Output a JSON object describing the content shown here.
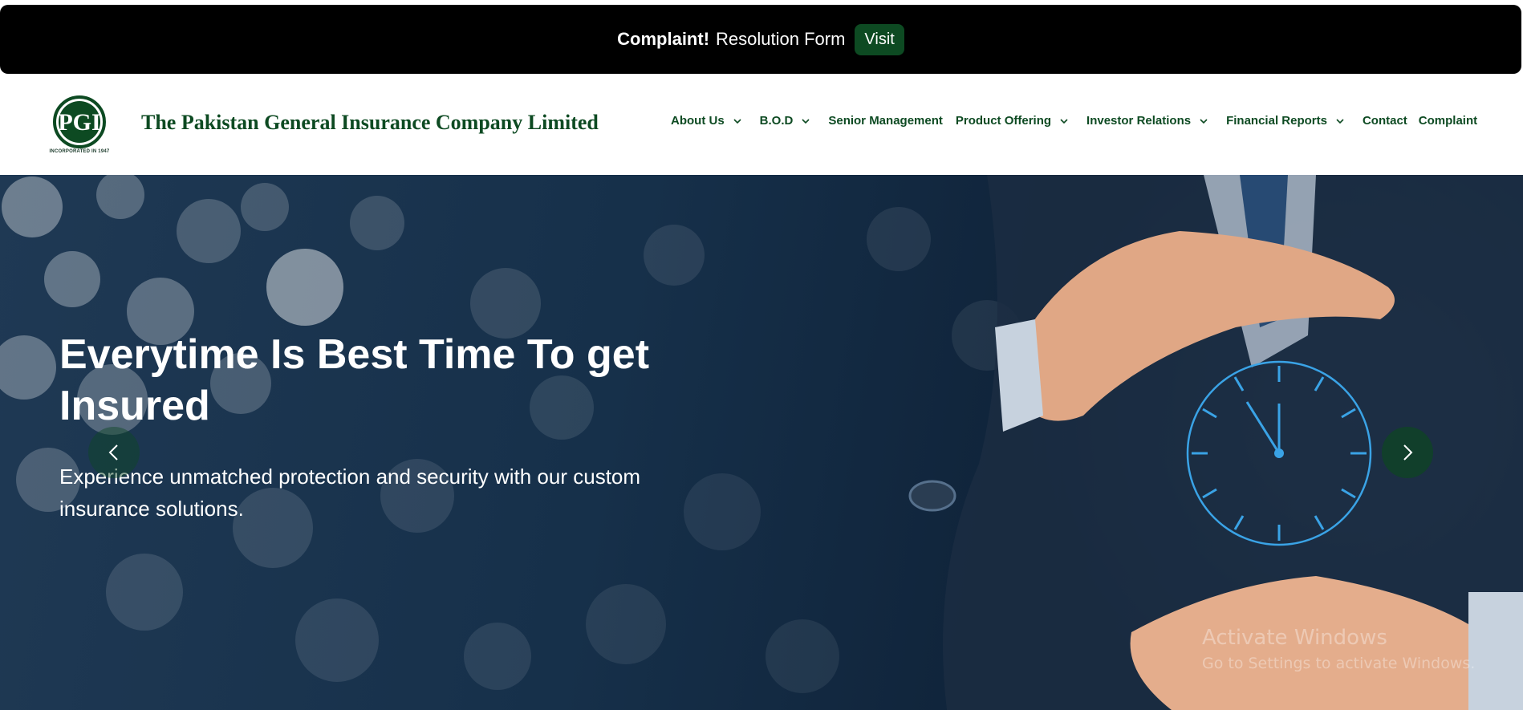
{
  "topbar": {
    "strong": "Complaint!",
    "text": "Resolution Form",
    "button": "Visit"
  },
  "header": {
    "logo_text": "PGI",
    "logo_caption": "INCORPORATED IN 1947",
    "company_name": "The Pakistan General Insurance Company Limited",
    "nav": [
      {
        "label": "About Us",
        "dropdown": true
      },
      {
        "label": "B.O.D",
        "dropdown": true
      },
      {
        "label": "Senior Management",
        "dropdown": false
      },
      {
        "label": "Product Offering",
        "dropdown": true
      },
      {
        "label": "Investor Relations",
        "dropdown": true
      },
      {
        "label": "Financial Reports",
        "dropdown": true
      },
      {
        "label": "Contact",
        "dropdown": false
      },
      {
        "label": "Complaint",
        "dropdown": false
      }
    ]
  },
  "hero": {
    "title": "Everytime Is Best Time To get Insured",
    "subtitle": "Experience unmatched protection and security with our custom insurance solutions.",
    "prev_icon": "chevron-left-icon",
    "next_icon": "chevron-right-icon"
  },
  "watermark": {
    "line1": "Activate Windows",
    "line2": "Go to Settings to activate Windows."
  },
  "colors": {
    "brand_green": "#0d4a22",
    "topbar_bg": "#000000",
    "hero_bg": "#16304a"
  }
}
